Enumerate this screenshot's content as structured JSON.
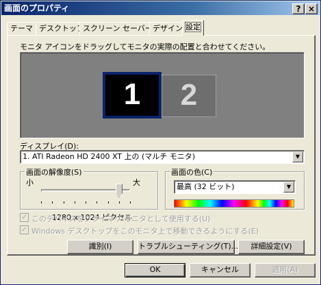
{
  "window": {
    "title": "画面のプロパティ",
    "help_glyph": "?",
    "close_glyph": "×"
  },
  "tabs": [
    {
      "label": "テーマ"
    },
    {
      "label": "デスクトップ"
    },
    {
      "label": "スクリーン セーバー"
    },
    {
      "label": "デザイン"
    },
    {
      "label": "設定"
    }
  ],
  "settings": {
    "instruction": "モニタ アイコンをドラッグしてモニタの実際の配置と合わせてください。",
    "monitors": [
      {
        "number": "1",
        "selected": true
      },
      {
        "number": "2",
        "selected": false
      }
    ],
    "display_label": "ディスプレイ(D):",
    "display_value": "1. ATI Radeon HD 2400 XT 上の (マルチ モニタ)",
    "resolution": {
      "group_label": "画面の解像度(S)",
      "min_label": "小",
      "max_label": "大",
      "value_text": "1280 x 1024 ピクセル",
      "slider_level_fraction": 0.875
    },
    "color": {
      "group_label": "画面の色(C)",
      "value": "最高 (32 ビット)"
    },
    "checkbox_primary": "このデバイスをプライマリ モニタとして使用する(U)",
    "checkbox_extend": "Windows デスクトップをこのモニタ上で移動できるようにする(E)",
    "buttons": {
      "identify": "識別(I)",
      "troubleshoot": "トラブルシューティング(T)...",
      "advanced": "詳細設定(V)"
    }
  },
  "footer": {
    "ok": "OK",
    "cancel": "キャンセル",
    "apply": "適用(A)"
  },
  "colors": {
    "titlebar_start": "#0a246a",
    "monitor_area_bg": "#808080",
    "selected_monitor_border": "#0a246a"
  }
}
